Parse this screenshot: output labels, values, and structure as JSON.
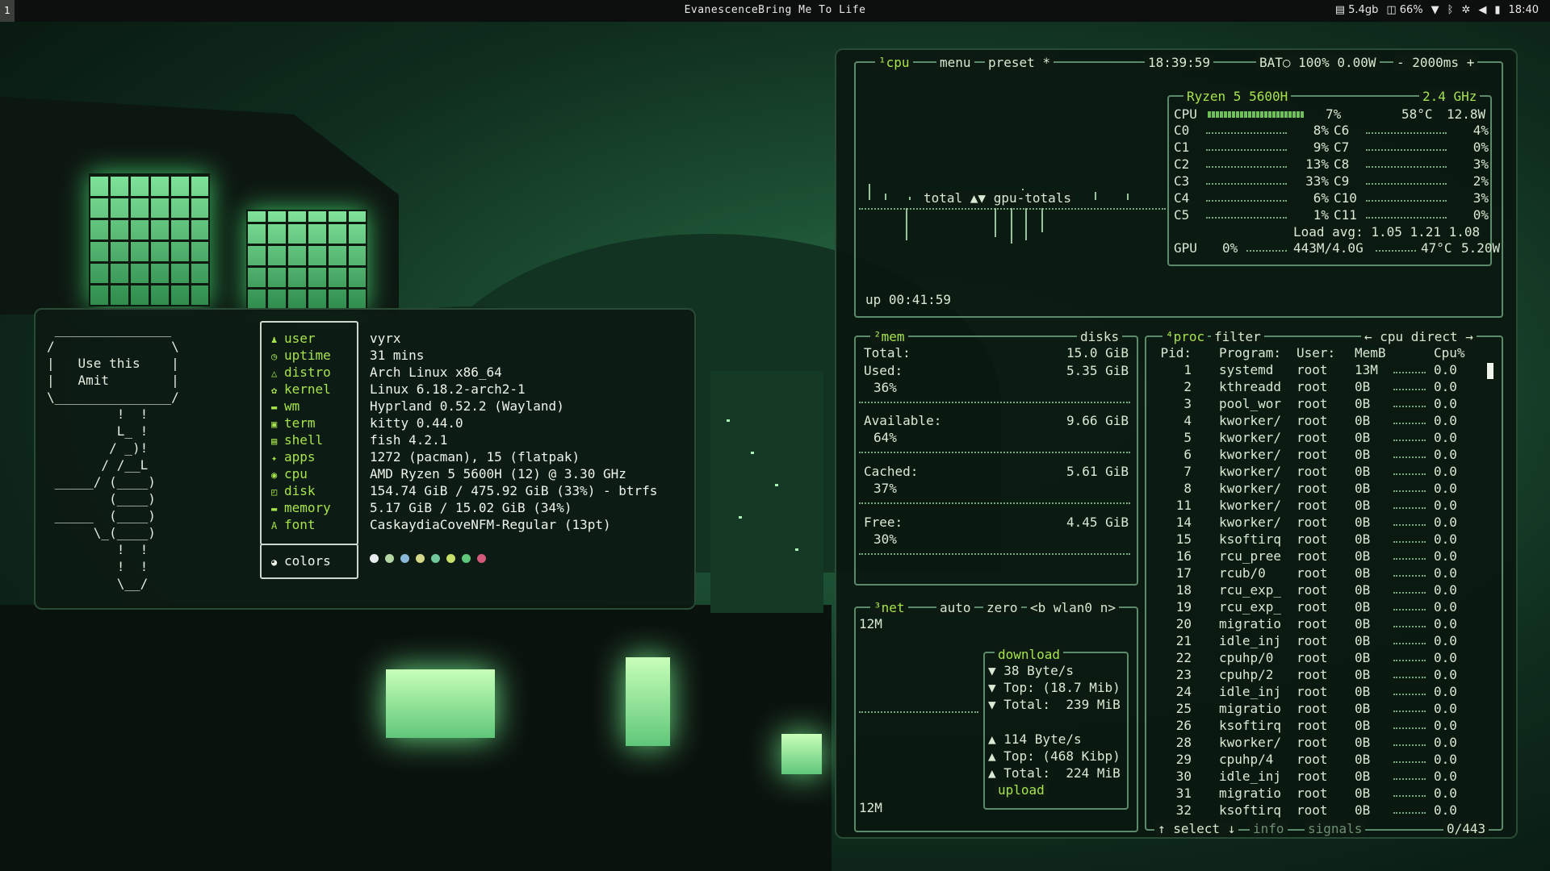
{
  "topbar": {
    "workspace": "1",
    "now_playing": "EvanescenceBring Me To Life",
    "tray": [
      {
        "icon": "memory-icon",
        "text": "5.4gb"
      },
      {
        "icon": "cpu-icon",
        "text": "66%"
      },
      {
        "icon": "wifi-icon",
        "text": ""
      },
      {
        "icon": "bluetooth-icon",
        "text": ""
      },
      {
        "icon": "settings-icon",
        "text": ""
      },
      {
        "icon": "volume-icon",
        "text": ""
      },
      {
        "icon": "battery-icon",
        "text": ""
      },
      {
        "icon": "clock-icon",
        "text": "18:40"
      }
    ]
  },
  "fastfetch": {
    "ascii_lines": [
      " _______________",
      "/               \\",
      "|   Use this    |",
      "|   Amit        |",
      "\\_______________/",
      "         !  !",
      "         L_ !",
      "        / _)!",
      "       / /__L",
      " _____/ (____)",
      "        (____)",
      " _____  (____)",
      "      \\_(____)",
      "         !  !",
      "         !  !",
      "         \\__/"
    ],
    "keys": [
      "user",
      "uptime",
      "distro",
      "kernel",
      "wm",
      "term",
      "shell",
      "apps",
      "cpu",
      "disk",
      "memory",
      "font"
    ],
    "key_icons": [
      "user-icon",
      "clock-icon",
      "arch-icon",
      "gear-icon",
      "window-icon",
      "terminal-icon",
      "shell-icon",
      "package-icon",
      "cpu-icon",
      "disk-icon",
      "memory-icon",
      "font-icon"
    ],
    "values": [
      "vyrx",
      "31 mins",
      "Arch Linux x86_64",
      "Linux 6.18.2-arch2-1",
      "Hyprland 0.52.2 (Wayland)",
      "kitty 0.44.0",
      "fish 4.2.1",
      "1272 (pacman), 15 (flatpak)",
      "AMD Ryzen 5 5600H (12) @ 3.30 GHz",
      "154.74 GiB / 475.92 GiB (33%) - btrfs",
      "5.17 GiB / 15.02 GiB (34%)",
      "CaskaydiaCoveNFM-Regular (13pt)"
    ],
    "colors_label": "colors",
    "color_dots": [
      "#e8ecee",
      "#b3d8a6",
      "#8ab8d8",
      "#d6d98a",
      "#6fc99a",
      "#c8e06a",
      "#5fc77a",
      "#d35a7a"
    ]
  },
  "btop": {
    "cpu_box": {
      "tabs": [
        "¹cpu",
        "menu",
        "preset *"
      ],
      "clock": "18:39:59",
      "battery": "BAT○ 100% 0.00W",
      "interval": "- 2000ms +",
      "graph_label": "total ▲▼ gpu-totals",
      "uptime": "up 00:41:59",
      "model": "Ryzen 5 5600H",
      "freq": "2.4 GHz",
      "total": {
        "label": "CPU",
        "pct": "7%",
        "temp": "58°C",
        "power": "12.8W"
      },
      "cores_left": [
        {
          "name": "C0",
          "pct": "8%"
        },
        {
          "name": "C1",
          "pct": "9%"
        },
        {
          "name": "C2",
          "pct": "13%"
        },
        {
          "name": "C3",
          "pct": "33%"
        },
        {
          "name": "C4",
          "pct": "6%"
        },
        {
          "name": "C5",
          "pct": "1%"
        }
      ],
      "cores_right": [
        {
          "name": "C6",
          "pct": "4%"
        },
        {
          "name": "C7",
          "pct": "0%"
        },
        {
          "name": "C8",
          "pct": "3%"
        },
        {
          "name": "C9",
          "pct": "2%"
        },
        {
          "name": "C10",
          "pct": "3%"
        },
        {
          "name": "C11",
          "pct": "0%"
        }
      ],
      "load_avg": "Load avg: 1.05 1.21 1.08",
      "gpu": {
        "label": "GPU",
        "pct": "0%",
        "mem": "443M/4.0G",
        "temp": "47°C",
        "power": "5.20W"
      }
    },
    "mem_box": {
      "title": "²mem",
      "disks_label": "disks",
      "rows": [
        {
          "label": "Total:",
          "value": "15.0 GiB",
          "pct": ""
        },
        {
          "label": "Used:",
          "value": "5.35 GiB",
          "pct": "36%"
        },
        {
          "label": "Available:",
          "value": "9.66 GiB",
          "pct": "64%"
        },
        {
          "label": "Cached:",
          "value": "5.61 GiB",
          "pct": "37%"
        },
        {
          "label": "Free:",
          "value": "4.45 GiB",
          "pct": "30%"
        }
      ]
    },
    "net_box": {
      "title": "³net",
      "tabs": [
        "auto",
        "zero",
        "<b wlan0 n>"
      ],
      "scale_top": "12M",
      "scale_bottom": "12M",
      "download_label": "download",
      "download": [
        "▼ 38 Byte/s",
        "▼ Top: (18.7 Mib)",
        "▼ Total:  239 MiB"
      ],
      "upload": [
        "▲ 114 Byte/s",
        "▲ Top: (468 Kibp)",
        "▲ Total:  224 MiB"
      ],
      "upload_label": "upload"
    },
    "proc_box": {
      "title": "⁴proc",
      "filter_label": "filter",
      "sort_label": "← cpu direct →",
      "headers": [
        "Pid:",
        "Program:",
        "User:",
        "MemB",
        "Cpu%"
      ],
      "rows": [
        [
          "1",
          "systemd",
          "root",
          "13M",
          "0.0"
        ],
        [
          "2",
          "kthreadd",
          "root",
          "0B",
          "0.0"
        ],
        [
          "3",
          "pool_wor",
          "root",
          "0B",
          "0.0"
        ],
        [
          "4",
          "kworker/",
          "root",
          "0B",
          "0.0"
        ],
        [
          "5",
          "kworker/",
          "root",
          "0B",
          "0.0"
        ],
        [
          "6",
          "kworker/",
          "root",
          "0B",
          "0.0"
        ],
        [
          "7",
          "kworker/",
          "root",
          "0B",
          "0.0"
        ],
        [
          "8",
          "kworker/",
          "root",
          "0B",
          "0.0"
        ],
        [
          "11",
          "kworker/",
          "root",
          "0B",
          "0.0"
        ],
        [
          "14",
          "kworker/",
          "root",
          "0B",
          "0.0"
        ],
        [
          "15",
          "ksoftirq",
          "root",
          "0B",
          "0.0"
        ],
        [
          "16",
          "rcu_pree",
          "root",
          "0B",
          "0.0"
        ],
        [
          "17",
          "rcub/0",
          "root",
          "0B",
          "0.0"
        ],
        [
          "18",
          "rcu_exp_",
          "root",
          "0B",
          "0.0"
        ],
        [
          "19",
          "rcu_exp_",
          "root",
          "0B",
          "0.0"
        ],
        [
          "20",
          "migratio",
          "root",
          "0B",
          "0.0"
        ],
        [
          "21",
          "idle_inj",
          "root",
          "0B",
          "0.0"
        ],
        [
          "22",
          "cpuhp/0",
          "root",
          "0B",
          "0.0"
        ],
        [
          "23",
          "cpuhp/2",
          "root",
          "0B",
          "0.0"
        ],
        [
          "24",
          "idle_inj",
          "root",
          "0B",
          "0.0"
        ],
        [
          "25",
          "migratio",
          "root",
          "0B",
          "0.0"
        ],
        [
          "26",
          "ksoftirq",
          "root",
          "0B",
          "0.0"
        ],
        [
          "28",
          "kworker/",
          "root",
          "0B",
          "0.0"
        ],
        [
          "29",
          "cpuhp/4",
          "root",
          "0B",
          "0.0"
        ],
        [
          "30",
          "idle_inj",
          "root",
          "0B",
          "0.0"
        ],
        [
          "31",
          "migratio",
          "root",
          "0B",
          "0.0"
        ],
        [
          "32",
          "ksoftirq",
          "root",
          "0B",
          "0.0"
        ]
      ],
      "footer_select": "↑ select ↓",
      "footer_info": "info",
      "footer_signals": "signals",
      "footer_count": "0/443"
    }
  }
}
